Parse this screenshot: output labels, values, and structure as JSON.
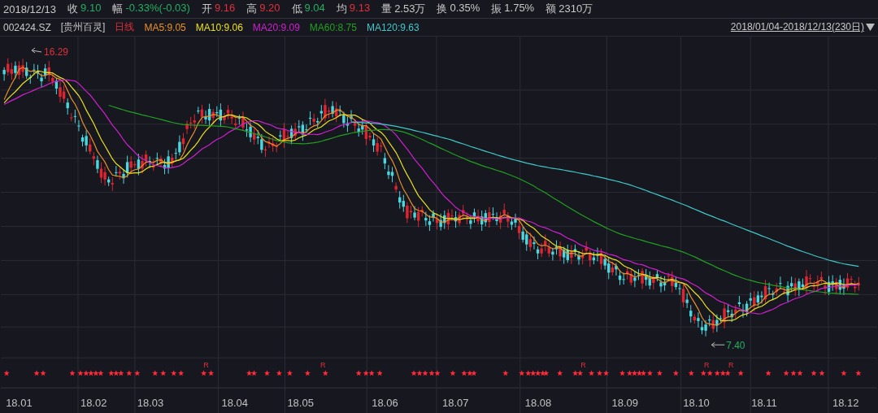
{
  "quote_bar": {
    "date": "2018/12/13",
    "items": [
      {
        "label": "收",
        "value": "9.10",
        "color": "#22b060"
      },
      {
        "label": "幅",
        "value": "-0.33%(-0.03)",
        "color": "#22b060"
      },
      {
        "label": "开",
        "value": "9.16",
        "color": "#e0303a"
      },
      {
        "label": "高",
        "value": "9.20",
        "color": "#e0303a"
      },
      {
        "label": "低",
        "value": "9.04",
        "color": "#22b060"
      },
      {
        "label": "均",
        "value": "9.13",
        "color": "#e0303a"
      },
      {
        "label": "量",
        "value": "2.53万",
        "color": "#c8c8c8"
      },
      {
        "label": "换",
        "value": "0.35%",
        "color": "#c8c8c8"
      },
      {
        "label": "振",
        "value": "1.75%",
        "color": "#c8c8c8"
      },
      {
        "label": "额",
        "value": "2310万",
        "color": "#c8c8c8"
      }
    ]
  },
  "legend": {
    "code": "002424.SZ",
    "name": "[贵州百灵]",
    "period": "日线",
    "averages": [
      {
        "label": "MA5:9.05",
        "color": "#e8902a"
      },
      {
        "label": "MA10:9.06",
        "color": "#e8e020"
      },
      {
        "label": "MA20:9.09",
        "color": "#d020d0"
      },
      {
        "label": "MA60:8.75",
        "color": "#20a020"
      },
      {
        "label": "MA120:9.63",
        "color": "#40c8c8"
      }
    ],
    "range": "2018/01/04-2018/12/13(230日)"
  },
  "chart": {
    "high_label": "16.29",
    "low_label": "7.40",
    "r_markers": [
      "R",
      "R",
      "R",
      "R",
      "R"
    ],
    "x_labels": [
      "18.01",
      "18.02",
      "18.03",
      "18.04",
      "18.05",
      "18.06",
      "18.07",
      "18.08",
      "18.09",
      "18.10",
      "18.11",
      "18.12"
    ]
  }
}
